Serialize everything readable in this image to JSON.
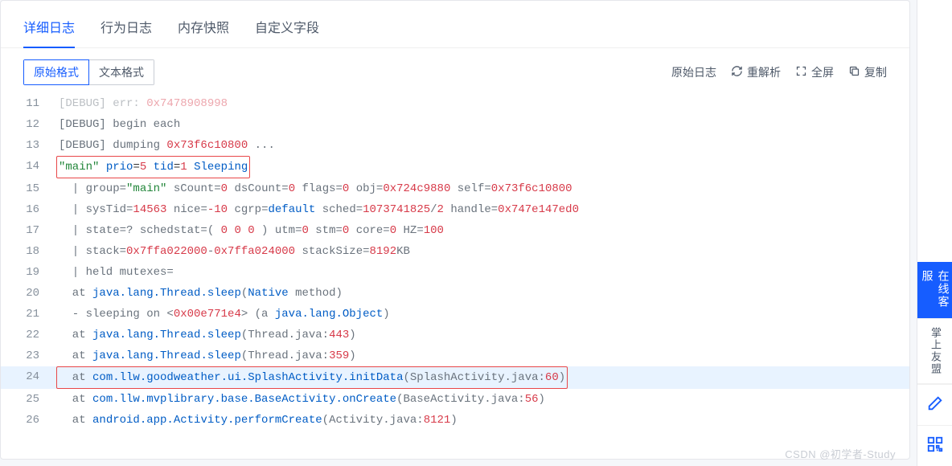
{
  "tabs": [
    {
      "label": "详细日志",
      "active": true
    },
    {
      "label": "行为日志",
      "active": false
    },
    {
      "label": "内存快照",
      "active": false
    },
    {
      "label": "自定义字段",
      "active": false
    }
  ],
  "format_buttons": [
    {
      "label": "原始格式",
      "active": true
    },
    {
      "label": "文本格式",
      "active": false
    }
  ],
  "actions": {
    "raw_log": "原始日志",
    "reparse": "重解析",
    "fullscreen": "全屏",
    "copy": "复制"
  },
  "sidebar": {
    "online_service": "在线客服",
    "palm_umeng": "掌上友盟"
  },
  "watermark": "CSDN @初学者-Study",
  "code": {
    "lines": [
      {
        "n": 11,
        "tokens": [
          {
            "t": "[DEBUG] err: ",
            "c": "t-g",
            "strike": true
          },
          {
            "t": "0x7478908998",
            "c": "t-r",
            "strike": true
          }
        ]
      },
      {
        "n": 12,
        "tokens": [
          {
            "t": "[DEBUG] begin each",
            "c": "t-g"
          }
        ]
      },
      {
        "n": 13,
        "tokens": [
          {
            "t": "[DEBUG] dumping ",
            "c": "t-g"
          },
          {
            "t": "0x73f6c10800",
            "c": "t-r"
          },
          {
            "t": " ...",
            "c": "t-g"
          }
        ]
      },
      {
        "n": 14,
        "box": true,
        "tokens": [
          {
            "t": "\"main\"",
            "c": "t-gr"
          },
          {
            "t": " prio",
            "c": "t-b"
          },
          {
            "t": "=",
            "c": "t-k"
          },
          {
            "t": "5",
            "c": "t-r"
          },
          {
            "t": " tid",
            "c": "t-b"
          },
          {
            "t": "=",
            "c": "t-k"
          },
          {
            "t": "1",
            "c": "t-r"
          },
          {
            "t": " Sleeping",
            "c": "t-b"
          }
        ]
      },
      {
        "n": 15,
        "tokens": [
          {
            "t": "  | group=",
            "c": "t-g"
          },
          {
            "t": "\"main\"",
            "c": "t-gr"
          },
          {
            "t": " sCount=",
            "c": "t-g"
          },
          {
            "t": "0",
            "c": "t-r"
          },
          {
            "t": " dsCount=",
            "c": "t-g"
          },
          {
            "t": "0",
            "c": "t-r"
          },
          {
            "t": " flags=",
            "c": "t-g"
          },
          {
            "t": "0",
            "c": "t-r"
          },
          {
            "t": " obj=",
            "c": "t-g"
          },
          {
            "t": "0x724c9880",
            "c": "t-r"
          },
          {
            "t": " self=",
            "c": "t-g"
          },
          {
            "t": "0x73f6c10800",
            "c": "t-r"
          }
        ]
      },
      {
        "n": 16,
        "tokens": [
          {
            "t": "  | sysTid=",
            "c": "t-g"
          },
          {
            "t": "14563",
            "c": "t-r"
          },
          {
            "t": " nice=",
            "c": "t-g"
          },
          {
            "t": "-10",
            "c": "t-r"
          },
          {
            "t": " cgrp=",
            "c": "t-g"
          },
          {
            "t": "default",
            "c": "t-b"
          },
          {
            "t": " sched=",
            "c": "t-g"
          },
          {
            "t": "1073741825",
            "c": "t-r"
          },
          {
            "t": "/",
            "c": "t-g"
          },
          {
            "t": "2",
            "c": "t-r"
          },
          {
            "t": " handle=",
            "c": "t-g"
          },
          {
            "t": "0x747e147ed0",
            "c": "t-r"
          }
        ]
      },
      {
        "n": 17,
        "tokens": [
          {
            "t": "  | state=? schedstat=( ",
            "c": "t-g"
          },
          {
            "t": "0 0 0",
            "c": "t-r"
          },
          {
            "t": " ) utm=",
            "c": "t-g"
          },
          {
            "t": "0",
            "c": "t-r"
          },
          {
            "t": " stm=",
            "c": "t-g"
          },
          {
            "t": "0",
            "c": "t-r"
          },
          {
            "t": " core=",
            "c": "t-g"
          },
          {
            "t": "0",
            "c": "t-r"
          },
          {
            "t": " HZ=",
            "c": "t-g"
          },
          {
            "t": "100",
            "c": "t-r"
          }
        ]
      },
      {
        "n": 18,
        "tokens": [
          {
            "t": "  | stack=",
            "c": "t-g"
          },
          {
            "t": "0x7ffa022000",
            "c": "t-r"
          },
          {
            "t": "-",
            "c": "t-g"
          },
          {
            "t": "0x7ffa024000",
            "c": "t-r"
          },
          {
            "t": " stackSize=",
            "c": "t-g"
          },
          {
            "t": "8192",
            "c": "t-r"
          },
          {
            "t": "KB",
            "c": "t-g"
          }
        ]
      },
      {
        "n": 19,
        "tokens": [
          {
            "t": "  | held mutexes=",
            "c": "t-g"
          }
        ]
      },
      {
        "n": 20,
        "tokens": [
          {
            "t": "  at ",
            "c": "t-g"
          },
          {
            "t": "java.lang.Thread.sleep",
            "c": "t-b"
          },
          {
            "t": "(",
            "c": "t-g"
          },
          {
            "t": "Native",
            "c": "t-b"
          },
          {
            "t": " method)",
            "c": "t-g"
          }
        ]
      },
      {
        "n": 21,
        "tokens": [
          {
            "t": "  - sleeping on <",
            "c": "t-g"
          },
          {
            "t": "0x00e771e4",
            "c": "t-r"
          },
          {
            "t": "> (a ",
            "c": "t-g"
          },
          {
            "t": "java.lang.Object",
            "c": "t-b"
          },
          {
            "t": ")",
            "c": "t-g"
          }
        ]
      },
      {
        "n": 22,
        "tokens": [
          {
            "t": "  at ",
            "c": "t-g"
          },
          {
            "t": "java.lang.Thread.sleep",
            "c": "t-b"
          },
          {
            "t": "(Thread.java:",
            "c": "t-g"
          },
          {
            "t": "443",
            "c": "t-r"
          },
          {
            "t": ")",
            "c": "t-g"
          }
        ]
      },
      {
        "n": 23,
        "tokens": [
          {
            "t": "  at ",
            "c": "t-g"
          },
          {
            "t": "java.lang.Thread.sleep",
            "c": "t-b"
          },
          {
            "t": "(Thread.java:",
            "c": "t-g"
          },
          {
            "t": "359",
            "c": "t-r"
          },
          {
            "t": ")",
            "c": "t-g"
          }
        ]
      },
      {
        "n": 24,
        "hl": true,
        "box": true,
        "tokens": [
          {
            "t": "  at ",
            "c": "t-g"
          },
          {
            "t": "com.llw.goodweather.ui.SplashActivity.initData",
            "c": "t-b"
          },
          {
            "t": "(SplashActivity.java:",
            "c": "t-g"
          },
          {
            "t": "60",
            "c": "t-r"
          },
          {
            "t": ")",
            "c": "t-g"
          }
        ]
      },
      {
        "n": 25,
        "tokens": [
          {
            "t": "  at ",
            "c": "t-g"
          },
          {
            "t": "com.llw.mvplibrary.base.BaseActivity.onCreate",
            "c": "t-b"
          },
          {
            "t": "(BaseActivity.java:",
            "c": "t-g"
          },
          {
            "t": "56",
            "c": "t-r"
          },
          {
            "t": ")",
            "c": "t-g"
          }
        ]
      },
      {
        "n": 26,
        "tokens": [
          {
            "t": "  at ",
            "c": "t-g"
          },
          {
            "t": "android.app.Activity.performCreate",
            "c": "t-b"
          },
          {
            "t": "(Activity.java:",
            "c": "t-g"
          },
          {
            "t": "8121",
            "c": "t-r"
          },
          {
            "t": ")",
            "c": "t-g"
          }
        ]
      }
    ]
  }
}
